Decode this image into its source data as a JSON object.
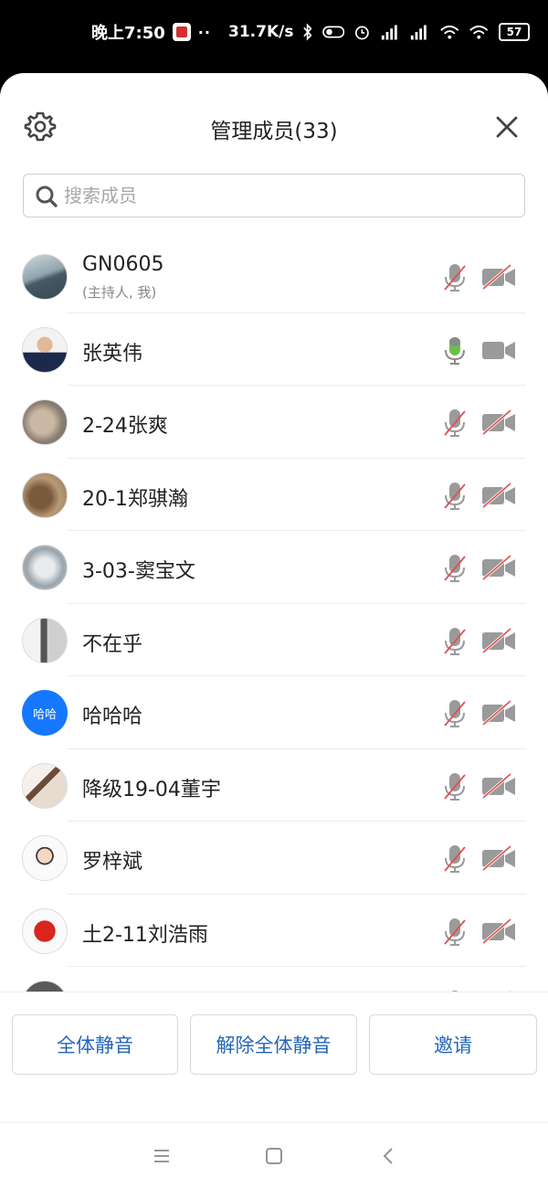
{
  "status_bar": {
    "time": "晚上7:50",
    "dots": "··",
    "net_speed": "31.7K/s",
    "battery": "57",
    "icons": [
      "app-badge-icon",
      "bluetooth-icon",
      "toggle-icon",
      "alarm-icon",
      "signal-hd-icon",
      "signal-hd-icon",
      "wifi-icon",
      "wifi-icon",
      "battery-icon"
    ]
  },
  "header": {
    "title": "管理成员(33)",
    "settings_icon": "gear-icon",
    "close_icon": "close-icon"
  },
  "search": {
    "placeholder": "搜索成员",
    "value": ""
  },
  "members": [
    {
      "name": "GN0605",
      "sub": "(主持人, 我)",
      "avatar": "landscape",
      "mic": "off",
      "cam": "off"
    },
    {
      "name": "张英伟",
      "sub": "",
      "avatar": "person",
      "mic": "on",
      "cam": "on"
    },
    {
      "name": "2-24张爽",
      "sub": "",
      "avatar": "cat",
      "mic": "off",
      "cam": "off"
    },
    {
      "name": "20-1郑骐瀚",
      "sub": "",
      "avatar": "photo-brown",
      "mic": "off",
      "cam": "off"
    },
    {
      "name": "3-03-窦宝文",
      "sub": "",
      "avatar": "snow",
      "mic": "off",
      "cam": "off"
    },
    {
      "name": "不在乎",
      "sub": "",
      "avatar": "grey-photo",
      "mic": "off",
      "cam": "off"
    },
    {
      "name": "哈哈哈",
      "sub": "",
      "avatar_text": "哈哈",
      "avatar": "text",
      "mic": "off",
      "cam": "off"
    },
    {
      "name": "降级19-04董宇",
      "sub": "",
      "avatar": "sketch",
      "mic": "off",
      "cam": "off"
    },
    {
      "name": "罗梓斌",
      "sub": "",
      "avatar": "cartoon",
      "mic": "off",
      "cam": "off"
    },
    {
      "name": "土2-11刘浩雨",
      "sub": "",
      "avatar": "maple",
      "mic": "off",
      "cam": "off"
    },
    {
      "name": "",
      "sub": "",
      "avatar": "partial",
      "mic": "off",
      "cam": "off"
    }
  ],
  "buttons": {
    "mute_all": "全体静音",
    "unmute_all": "解除全体静音",
    "invite": "邀请"
  },
  "colors": {
    "mic_on": "#6cc04a",
    "icon_grey": "#9a9a9a",
    "slash_red": "#e05050",
    "button_text": "#2466b8",
    "avatar_blue": "#1677ff"
  },
  "nav": [
    "menu-icon",
    "home-icon",
    "back-icon"
  ]
}
